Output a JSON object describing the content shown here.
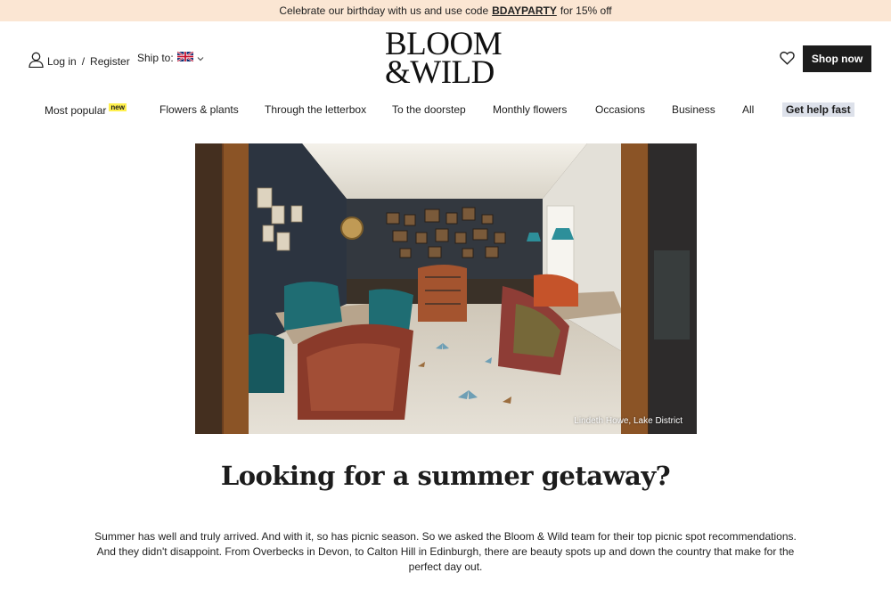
{
  "promo": {
    "text_before": "Celebrate our birthday with us and use code",
    "code": "BDAYPARTY",
    "text_after": "for 15% off"
  },
  "header": {
    "login_label": "Log in",
    "separator": "/",
    "register_label": "Register",
    "ship_to_label": "Ship to:",
    "ship_country_icon": "uk-flag-icon",
    "logo_line1": "BLOOM",
    "logo_line2": "&WILD",
    "wishlist_icon": "heart-icon",
    "shop_now_label": "Shop now"
  },
  "nav": {
    "items": [
      {
        "label": "Most popular",
        "badge": "new"
      },
      {
        "label": "Flowers & plants"
      },
      {
        "label": "Through the letterbox"
      },
      {
        "label": "To the doorstep"
      },
      {
        "label": "Monthly flowers"
      },
      {
        "label": "Occasions"
      },
      {
        "label": "Business"
      },
      {
        "label": "All"
      },
      {
        "label": "Get help fast"
      }
    ]
  },
  "hero": {
    "caption": "Lindeth Howe, Lake District"
  },
  "article": {
    "title": "Looking for a summer getaway?",
    "intro": "Summer has well and truly arrived. And with it, so has picnic season. So we asked the Bloom & Wild team for their top picnic spot recommendations. And they didn't disappoint. From Overbecks in Devon, to Calton Hill in Edinburgh, there are beauty spots up and down the country that make for the perfect day out."
  },
  "colors": {
    "promo_bg": "#fbe6d3",
    "shop_now_bg": "#1c1c1c",
    "badge_bg": "#fff04d",
    "help_bg": "#dde1ea"
  }
}
